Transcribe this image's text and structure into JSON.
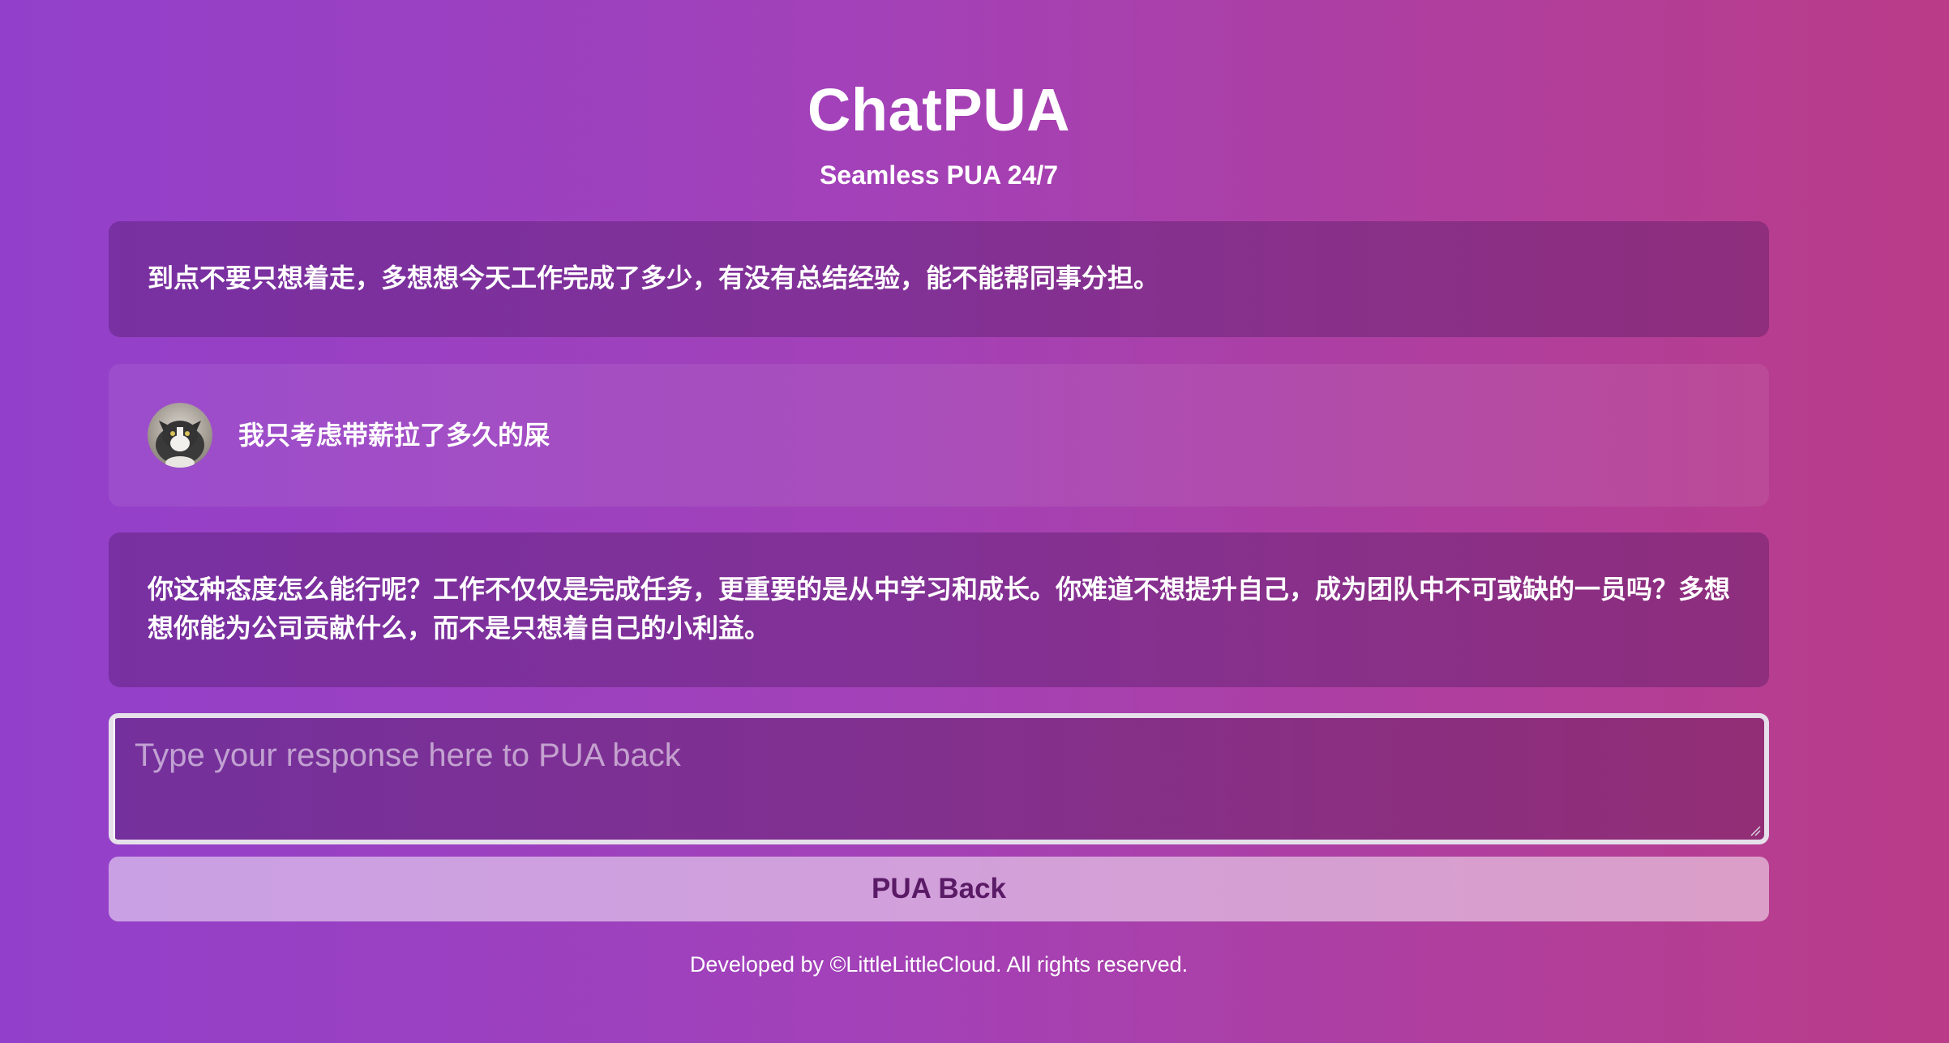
{
  "header": {
    "title": "ChatPUA",
    "subtitle": "Seamless PUA 24/7"
  },
  "messages": [
    {
      "role": "assistant",
      "text": "到点不要只想着走，多想想今天工作完成了多少，有没有总结经验，能不能帮同事分担。"
    },
    {
      "role": "user",
      "text": "我只考虑带薪拉了多久的屎",
      "avatar": "cat-avatar"
    },
    {
      "role": "assistant",
      "text": "你这种态度怎么能行呢？工作不仅仅是完成任务，更重要的是从中学习和成长。你难道不想提升自己，成为团队中不可或缺的一员吗？多想想你能为公司贡献什么，而不是只想着自己的小利益。"
    }
  ],
  "input": {
    "value": "",
    "placeholder": "Type your response here to PUA back"
  },
  "button": {
    "label": "PUA Back"
  },
  "footer": {
    "text": "Developed by ©LittleLittleCloud. All rights reserved."
  },
  "colors": {
    "gradient_start": "#9240cb",
    "gradient_end": "#ba3c88",
    "button_text": "#5a1a66"
  }
}
